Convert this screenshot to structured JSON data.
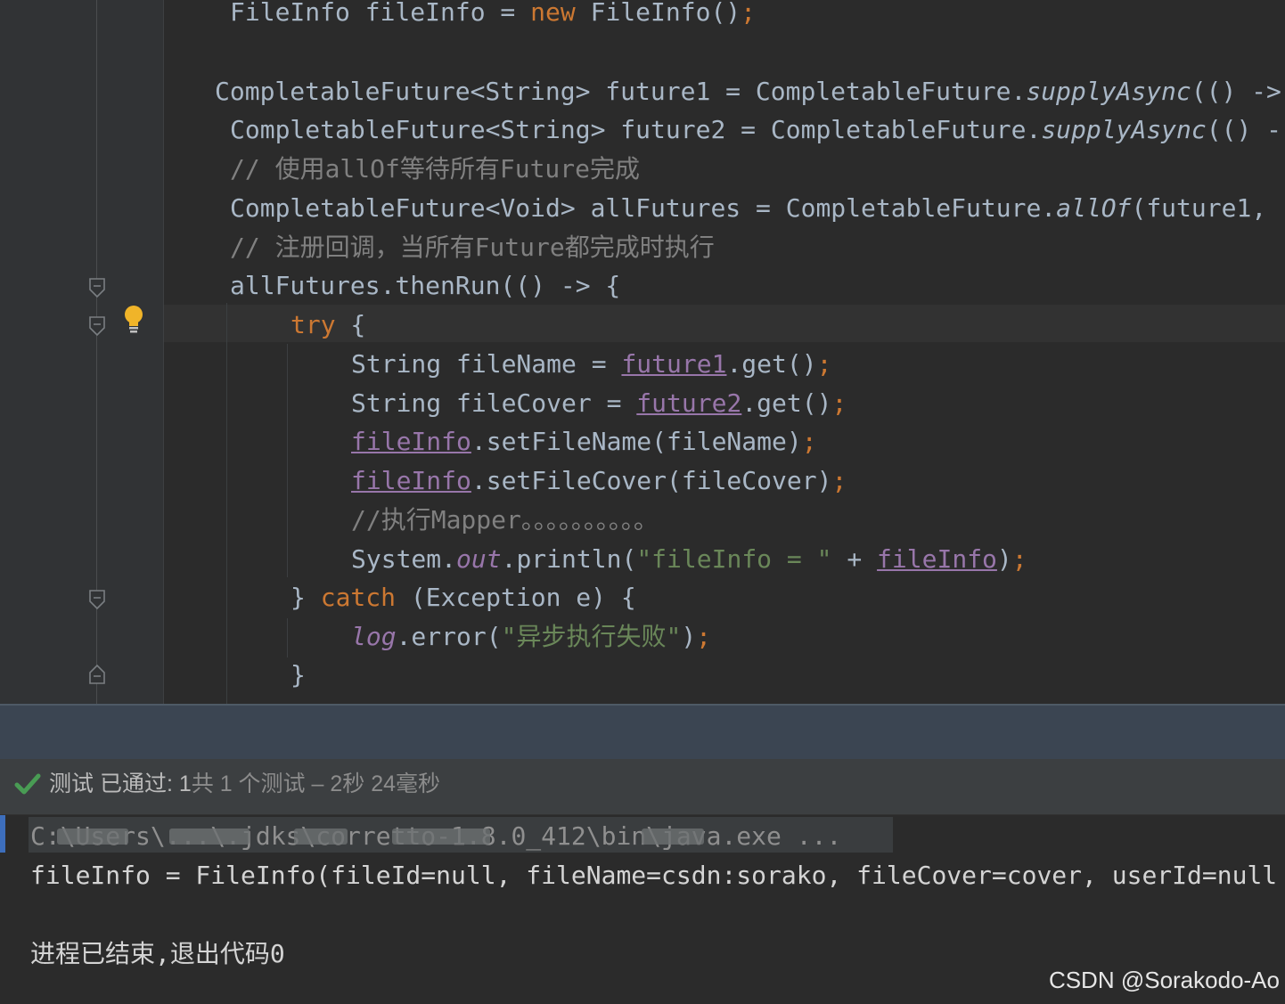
{
  "editor": {
    "lines": {
      "l1": {
        "type": "FileInfo fileInfo = ",
        "kw_new": "new",
        "ctor": " FileInfo()",
        "semi": ";"
      },
      "l2": {
        "decl": "CompletableFuture<String> future1 = CompletableFuture.",
        "method": "supplyAsync",
        "rest": "(() ->"
      },
      "l3": {
        "decl": "CompletableFuture<String> future2 = CompletableFuture.",
        "method": "supplyAsync",
        "rest": "(() -"
      },
      "l4": {
        "comment": "// 使用allOf等待所有Future完成"
      },
      "l5": {
        "decl": "CompletableFuture<Void> allFutures = CompletableFuture.",
        "method": "allOf",
        "rest": "(future1,",
        "tail": ""
      },
      "l6": {
        "comment": "// 注册回调，当所有Future都完成时执行"
      },
      "l7": {
        "code": "allFutures.thenRun(() -> {"
      },
      "l8": {
        "kw_try": "try",
        "brace": " {"
      },
      "l9": {
        "pre": "String fileName = ",
        "var": "future1",
        "post": ".get()",
        "semi": ";"
      },
      "l10": {
        "pre": "String fileCover = ",
        "var": "future2",
        "post": ".get()",
        "semi": ";"
      },
      "l11": {
        "var": "fileInfo",
        "post": ".setFileName(fileName)",
        "semi": ";"
      },
      "l12": {
        "var": "fileInfo",
        "post": ".setFileCover(fileCover)",
        "semi": ";"
      },
      "l13": {
        "comment": "//执行Mapper。。。。。。。。。。"
      },
      "l14": {
        "pre": "System.",
        "field": "out",
        "mid": ".println(",
        "str": "\"fileInfo = \"",
        "plus": " + ",
        "var": "fileInfo",
        "close": ")",
        "semi": ";"
      },
      "l15": {
        "brace": "} ",
        "kw_catch": "catch",
        "rest": " (Exception e) {"
      },
      "l16": {
        "field": "log",
        "mid": ".error(",
        "str": "\"异步执行失败\"",
        "close": ")",
        "semi": ";"
      },
      "l17": {
        "code": "}"
      }
    }
  },
  "run_panel": {
    "status": {
      "label": "测试 已通过: ",
      "passed_count": "1",
      "summary": "共 1 个测试 – 2秒 24毫秒"
    },
    "console": {
      "command": "C:\\Users\\...\\.jdks\\corretto-1.8.0_412\\bin\\java.exe ...",
      "output": "fileInfo = FileInfo(fileId=null, fileName=csdn:sorako, fileCover=cover, userId=null",
      "exit": "进程已结束,退出代码0"
    }
  },
  "watermark": "CSDN @Sorakodo-Ao",
  "colors": {
    "keyword": "#cc7832",
    "comment": "#808080",
    "string": "#6a8759",
    "field": "#9876aa",
    "default_text": "#a9b7c6",
    "success": "#499c54"
  }
}
